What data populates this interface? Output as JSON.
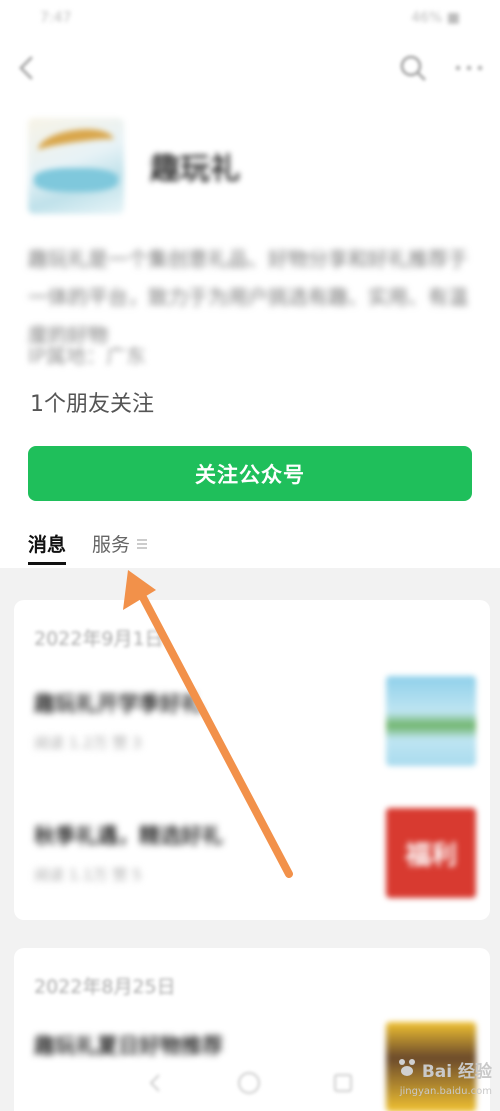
{
  "status_bar": {
    "left": "7:47",
    "right": "46% ■"
  },
  "account": {
    "name": "趣玩礼",
    "intro": "趣玩礼是一个集创意礼品、好物分享和好礼推荐于一体的平台，致力于为用户挑选有趣、实用、有温度的好物",
    "region": "IP属地：广东",
    "friends_following": "1个朋友关注"
  },
  "follow_button": {
    "label": "关注公众号"
  },
  "tabs": [
    {
      "label": "消息",
      "active": true
    },
    {
      "label": "服务",
      "active": false
    }
  ],
  "messages": {
    "date": "2022年9月1日",
    "articles": [
      {
        "title": "趣玩礼开学季好礼",
        "meta": "阅读 1.2万  赞 3",
        "thumb": "landscape"
      },
      {
        "title": "秋季礼遇，精选好礼",
        "meta": "阅读 1.1万  赞 5",
        "thumb_text": "福利"
      }
    ]
  },
  "second_card": {
    "date": "2022年8月25日",
    "article_title": "趣玩礼夏日好物推荐"
  },
  "watermark": {
    "brand": "Bai 经验",
    "url": "jingyan.baidu.com"
  },
  "colors": {
    "accent_green": "#1fbf5b",
    "annotation_arrow": "#f2914a"
  },
  "icons": {
    "back": "back-arrow-icon",
    "search": "search-icon",
    "more": "more-icon",
    "tab_menu": "menu-icon"
  }
}
